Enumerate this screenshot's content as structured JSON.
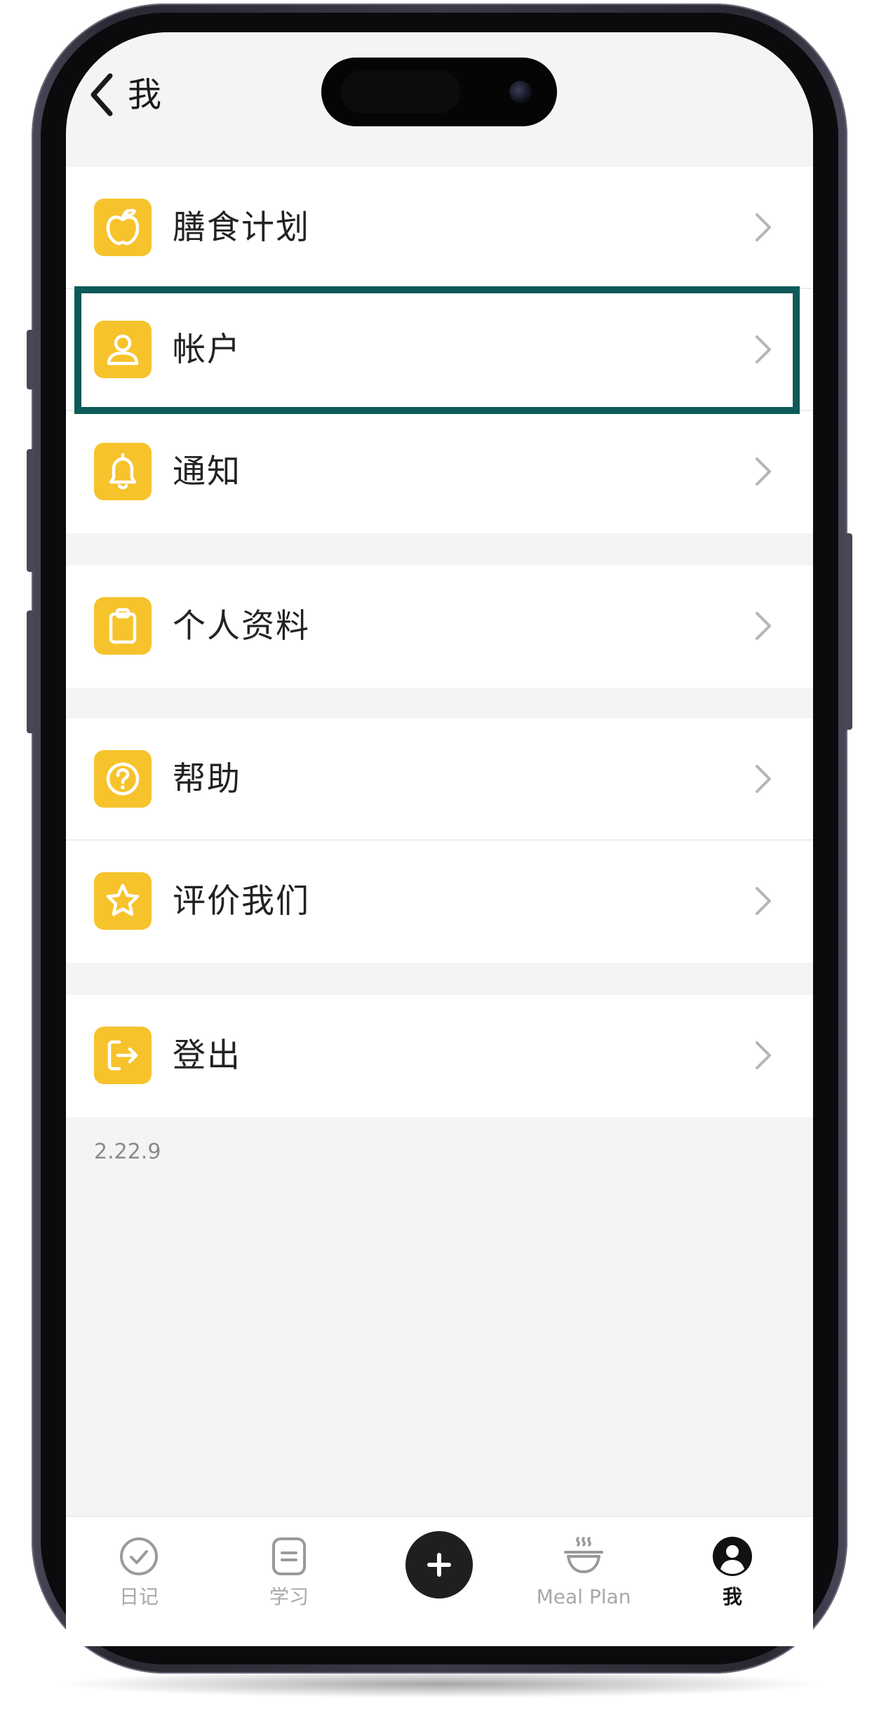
{
  "nav": {
    "title": "我"
  },
  "menu": {
    "group1": [
      {
        "label": "膳食计划",
        "icon": "apple-icon"
      },
      {
        "label": "帐户",
        "icon": "user-icon"
      },
      {
        "label": "通知",
        "icon": "bell-icon"
      }
    ],
    "group2": [
      {
        "label": "个人资料",
        "icon": "clipboard-icon"
      }
    ],
    "group3": [
      {
        "label": "帮助",
        "icon": "question-icon"
      },
      {
        "label": "评价我们",
        "icon": "star-icon"
      }
    ],
    "group4": [
      {
        "label": "登出",
        "icon": "logout-icon"
      }
    ]
  },
  "version": "2.22.9",
  "tabs": [
    {
      "label": "日记",
      "icon": "check-circle-icon",
      "active": false
    },
    {
      "label": "学习",
      "icon": "document-icon",
      "active": false
    },
    {
      "label": "",
      "icon": "plus-icon",
      "active": false
    },
    {
      "label": "Meal Plan",
      "icon": "bowl-icon",
      "active": false
    },
    {
      "label": "我",
      "icon": "profile-icon",
      "active": true
    }
  ],
  "colors": {
    "accent": "#f6c32c",
    "highlight": "#0d5a59",
    "background": "#f4f4f4"
  }
}
